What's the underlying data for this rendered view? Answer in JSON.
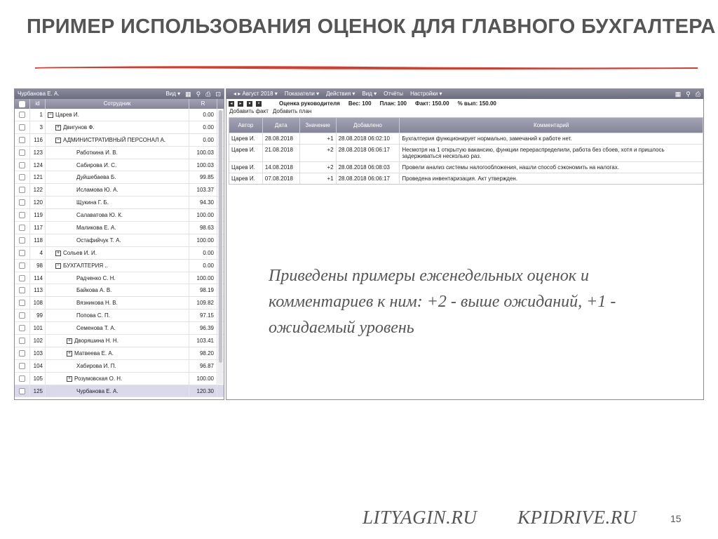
{
  "slide": {
    "title": "ПРИМЕР ИСПОЛЬЗОВАНИЯ ОЦЕНОК ДЛЯ ГЛАВНОГО БУХГАЛТЕРА",
    "annotation": "Приведены примеры еженедельных оценок и комментариев к ним: +2 - выше ожиданий, +1 - ожидаемый уровень",
    "footer_site_1": "LITYAGIN.RU",
    "footer_site_2": "KPIDRIVE.RU",
    "page_number": "15",
    "accent_color": "#d93a2b"
  },
  "left_panel": {
    "user": "Чурбанова Е. А.",
    "view_menu": "Вид ▾",
    "icons": [
      "grid-icon",
      "search-icon",
      "print-icon",
      "export-icon"
    ],
    "columns": {
      "id": "id",
      "employee": "Сотрудник",
      "rating": "R"
    },
    "rows": [
      {
        "id": "1",
        "name": "Царев И.",
        "r": "0.00",
        "level": 0,
        "expander": "minus"
      },
      {
        "id": "3",
        "name": "Двигунов Ф.",
        "r": "0.00",
        "level": 1,
        "expander": "plus"
      },
      {
        "id": "116",
        "name": "АДМИНИСТРАТИВНЫЙ ПЕРСОНАЛ А.",
        "r": "0.00",
        "level": 1,
        "expander": "minus"
      },
      {
        "id": "123",
        "name": "Работкина И. В.",
        "r": "100.03",
        "level": 2,
        "expander": ""
      },
      {
        "id": "124",
        "name": "Сабирова И. С.",
        "r": "100.03",
        "level": 2,
        "expander": ""
      },
      {
        "id": "121",
        "name": "Дуйшебаева Б.",
        "r": "99.85",
        "level": 2,
        "expander": ""
      },
      {
        "id": "122",
        "name": "Исламова Ю. А.",
        "r": "103.37",
        "level": 2,
        "expander": ""
      },
      {
        "id": "120",
        "name": "Щукина Г. Б.",
        "r": "94.30",
        "level": 2,
        "expander": ""
      },
      {
        "id": "119",
        "name": "Салаватова Ю. К.",
        "r": "100.00",
        "level": 2,
        "expander": ""
      },
      {
        "id": "117",
        "name": "Маликова Е. А.",
        "r": "98.63",
        "level": 2,
        "expander": ""
      },
      {
        "id": "118",
        "name": "Остафийчук Т. А.",
        "r": "100.00",
        "level": 2,
        "expander": ""
      },
      {
        "id": "4",
        "name": "Сольев И. И.",
        "r": "0.00",
        "level": 1,
        "expander": "plus"
      },
      {
        "id": "98",
        "name": "БУХГАЛТЕРИЯ ..",
        "r": "0.00",
        "level": 1,
        "expander": "minus"
      },
      {
        "id": "114",
        "name": "Радченко С. Н.",
        "r": "100.00",
        "level": 2,
        "expander": ""
      },
      {
        "id": "113",
        "name": "Байкова А. В.",
        "r": "98.19",
        "level": 2,
        "expander": ""
      },
      {
        "id": "108",
        "name": "Вязникова Н. В.",
        "r": "109.82",
        "level": 2,
        "expander": ""
      },
      {
        "id": "99",
        "name": "Попова С. П.",
        "r": "97.15",
        "level": 2,
        "expander": ""
      },
      {
        "id": "101",
        "name": "Семенова Т. А.",
        "r": "96.39",
        "level": 2,
        "expander": ""
      },
      {
        "id": "102",
        "name": "Дворяшина Н. Н.",
        "r": "103.41",
        "level": 2,
        "expander": "plus"
      },
      {
        "id": "103",
        "name": "Матвеева Е. А.",
        "r": "98.20",
        "level": 2,
        "expander": "plus"
      },
      {
        "id": "104",
        "name": "Хабирова И. П.",
        "r": "96.87",
        "level": 2,
        "expander": ""
      },
      {
        "id": "105",
        "name": "Розумовская О. Н.",
        "r": "100.00",
        "level": 2,
        "expander": "plus"
      },
      {
        "id": "125",
        "name": "Чурбанова Е. А.",
        "r": "120.30",
        "level": 2,
        "expander": "",
        "selected": true
      }
    ]
  },
  "right_panel": {
    "toolbar": {
      "period": "◂ ▸ Август 2018 ▾",
      "indicators": "Показатели ▾",
      "actions": "Действия ▾",
      "view": "Вид ▾",
      "reports": "Отчёты",
      "settings": "Настройки ▾"
    },
    "eval_info": {
      "title": "Оценка руководителя",
      "weight": "Вес: 100",
      "plan": "План: 100",
      "fact": "Факт: 150.00",
      "percent": "% вып: 150.00"
    },
    "add_fact": "Добавить факт",
    "add_plan": "Добавить план",
    "columns": {
      "author": "Автор",
      "date": "Дата",
      "value": "Значение",
      "added": "Добавлено",
      "comment": "Комментарий"
    },
    "rows": [
      {
        "author": "Царев И.",
        "date": "28.08.2018",
        "value": "+1",
        "added": "28.08.2018 06:02:10",
        "comment": "Бухгалтерия функционирует нормально, замечаний к работе нет."
      },
      {
        "author": "Царев И.",
        "date": "21.08.2018",
        "value": "+2",
        "added": "28.08.2018 06:06:17",
        "comment": "Несмотря на 1 открытую вакансию, функции перераспределили, работа без сбоев, хотя и пришлось задерживаться несколько раз."
      },
      {
        "author": "Царев И.",
        "date": "14.08.2018",
        "value": "+2",
        "added": "28.08.2018 06:08:03",
        "comment": "Провели анализ системы налогообложения, нашли способ сэкономить на налогах."
      },
      {
        "author": "Царев И.",
        "date": "07.08.2018",
        "value": "+1",
        "added": "28.08.2018 06:06:17",
        "comment": "Проведена инвентаризация. Акт утвержден."
      }
    ]
  }
}
